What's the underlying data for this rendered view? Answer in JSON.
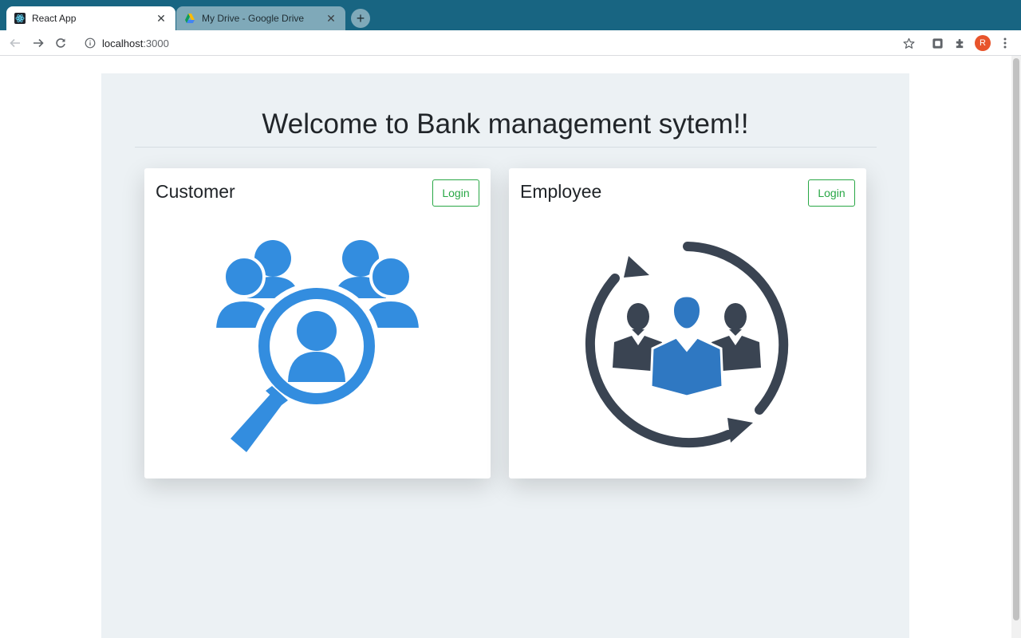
{
  "browser": {
    "tabs": [
      {
        "title": "React App",
        "active": true,
        "favicon": "react-icon"
      },
      {
        "title": "My Drive - Google Drive",
        "active": false,
        "favicon": "google-drive-icon"
      }
    ],
    "new_tab_label": "+",
    "close_glyph": "✕",
    "address": {
      "host": "localhost",
      "port": ":3000"
    },
    "avatar_initial": "R"
  },
  "page": {
    "title": "Welcome to Bank management sytem!!",
    "cards": [
      {
        "title": "Customer",
        "button_label": "Login",
        "illustration": "customer-search-icon"
      },
      {
        "title": "Employee",
        "button_label": "Login",
        "illustration": "employee-team-cycle-icon"
      }
    ]
  },
  "colors": {
    "tab_strip": "#186582",
    "jumbotron": "#ecf1f4",
    "login_green": "#28a745",
    "customer_blue": "#338ddf",
    "employee_dark": "#3a4452",
    "employee_blue": "#2f78c2"
  }
}
